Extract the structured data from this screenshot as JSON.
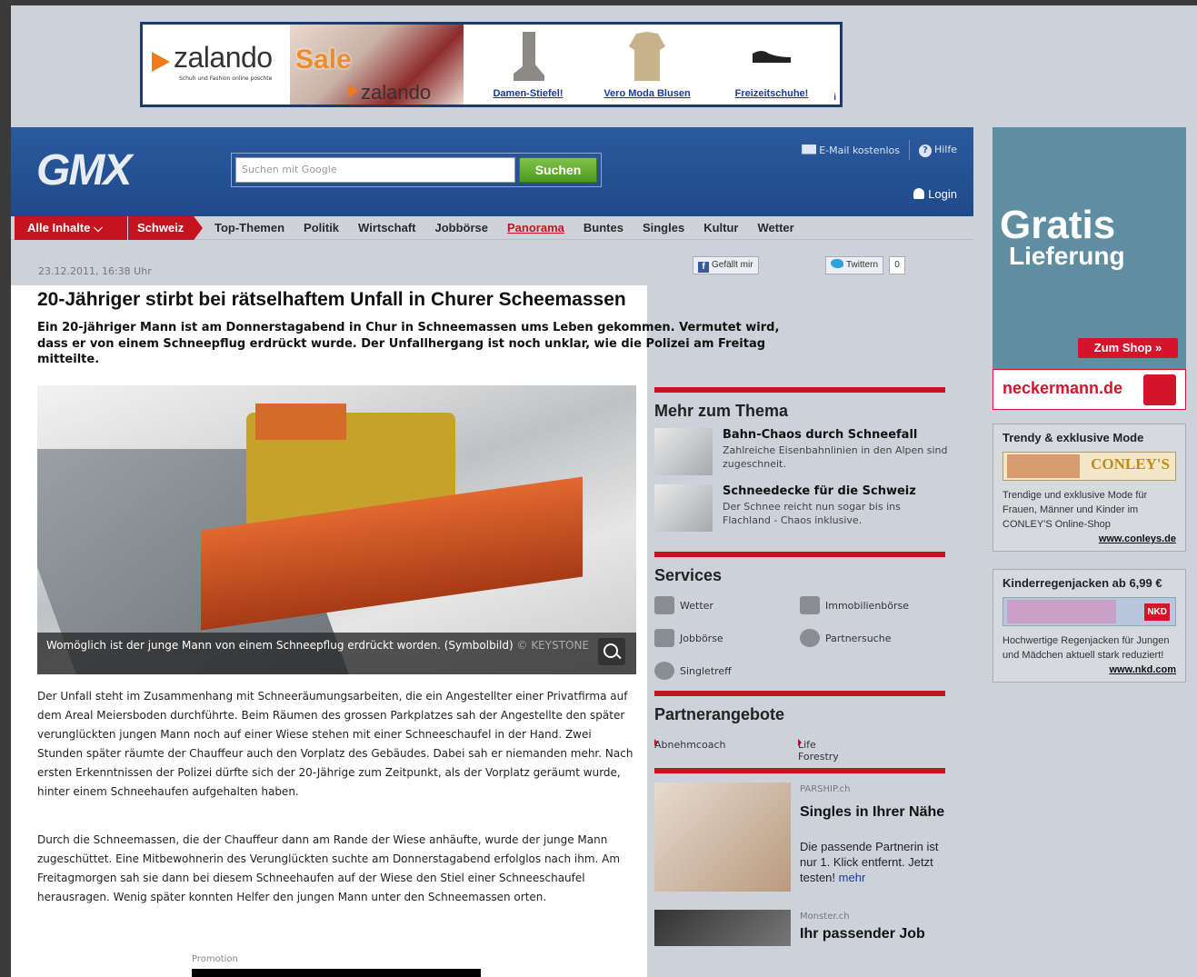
{
  "banner": {
    "brand": "zalando",
    "tagline": "Schuh und Fashion online poschte",
    "sale": "Sale",
    "brand_small": "zalando",
    "products": [
      {
        "label": "Damen-Stiefel!"
      },
      {
        "label": "Vero Moda Blusen"
      },
      {
        "label": "Freizeitschuhe!"
      }
    ],
    "info_mark": "i"
  },
  "header": {
    "logo": "GMX",
    "search_placeholder": "Suchen mit Google",
    "search_button": "Suchen",
    "email_link": "E-Mail kostenlos",
    "help_link": "Hilfe",
    "login": "Login"
  },
  "nav": {
    "all": "Alle Inhalte ⌵",
    "current": "Schweiz",
    "items": [
      "Top-Themen",
      "Politik",
      "Wirtschaft",
      "Jobbörse",
      "Panorama",
      "Buntes",
      "Singles",
      "Kultur",
      "Wetter"
    ],
    "active_index": 4
  },
  "meta": {
    "date": "23.12.2011, 16:38 Uhr",
    "fb_label": "Gefällt mir",
    "tw_label": "Twittern",
    "tw_count": "0"
  },
  "article": {
    "headline": "20-Jähriger stirbt bei rätselhaftem Unfall in Churer Scheemassen",
    "lead": "Ein 20-jähriger Mann ist am Donnerstagabend in Chur in Schneemassen ums Leben gekommen. Vermutet wird, dass er von einem Schneepflug erdrückt wurde. Der Unfallhergang ist noch unklar, wie die Polizei am Freitag mitteilte.",
    "caption": "Womöglich ist der junge Mann von einem Schneepflug erdrückt worden. (Symbolbild)",
    "credit": "© KEYSTONE",
    "paragraph1": "Der Unfall steht im Zusammenhang mit Schneeräumungsarbeiten, die ein Angestellter einer Privatfirma auf dem Areal Meiersboden durchführte. Beim Räumen des grossen Parkplatzes sah der Angestellte den später verunglückten jungen Mann noch auf einer Wiese stehen mit einer Schneeschaufel in der Hand. Zwei Stunden später räumte der Chauffeur auch den Vorplatz des Gebäudes. Dabei sah er niemanden mehr. Nach ersten Erkenntnissen der Polizei dürfte sich der 20-Jährige zum Zeitpunkt, als der Vorplatz geräumt wurde, hinter einem Schneehaufen aufgehalten haben.",
    "paragraph2": "Durch die Schneemassen, die der Chauffeur dann am Rande der Wiese anhäufte, wurde der junge Mann zugeschüttet. Eine Mitbewohnerin des Verunglückten suchte am Donnerstagabend erfolglos nach ihm. Am Freitagmorgen sah sie dann bei diesem Schneehaufen auf der Wiese den Stiel einer Schneeschaufel herausragen. Wenig später konnten Helfer den jungen Mann unter den Schneemassen orten.",
    "promotion": "Promotion"
  },
  "mehr": {
    "title": "Mehr zum Thema",
    "items": [
      {
        "title": "Bahn-Chaos durch Schneefall",
        "desc": "Zahlreiche Eisenbahnlinien in den Alpen sind zugeschneit."
      },
      {
        "title": "Schneedecke für die Schweiz",
        "desc": "Der Schnee reicht nun sogar bis ins Flachland - Chaos inklusive."
      }
    ]
  },
  "services": {
    "title": "Services",
    "items": [
      "Wetter",
      "Immobilienbörse",
      "Jobbörse",
      "Partnersuche",
      "Singletreff"
    ]
  },
  "partner": {
    "title": "Partnerangebote",
    "links": [
      "Abnehmcoach",
      "Life Forestry"
    ]
  },
  "parship": {
    "source": "PARSHIP.ch",
    "title": "Singles in Ihrer Nähe",
    "desc": "Die passende Partnerin ist nur 1. Klick entfernt. Jetzt testen!",
    "more": "mehr"
  },
  "monster": {
    "source": "Monster.ch",
    "title": "Ihr passender Job"
  },
  "ads": {
    "gratis": "Gratis",
    "lieferung": "Lieferung",
    "zum_shop": "Zum Shop »",
    "neckermann": "neckermann.de",
    "conleys": {
      "title": "Trendy & exklusive Mode",
      "brand": "CONLEY'S",
      "desc": "Trendige und exklusive Mode für Frauen, Männer und Kinder im CONLEY'S Online-Shop",
      "link": "www.conleys.de"
    },
    "nkd": {
      "title": "Kinderregenjacken ab 6,99 €",
      "brand": "NKD",
      "desc": "Hochwertige Regenjacken für Jungen und Mädchen aktuell stark reduziert!",
      "link": "www.nkd.com"
    }
  }
}
